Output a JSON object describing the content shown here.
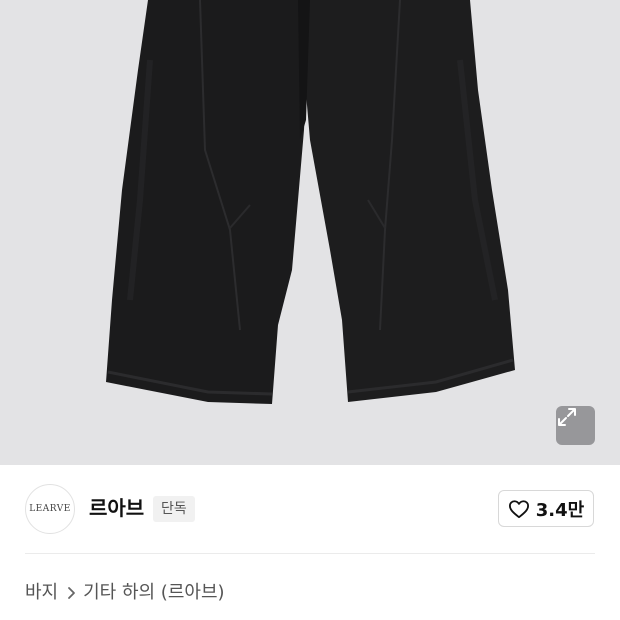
{
  "product_image": {
    "description_icon": "pants-photo",
    "expand_icon": "expand-icon"
  },
  "brand": {
    "logo_text": "LEARVE",
    "name": "르아브",
    "badge": "단독"
  },
  "like": {
    "icon": "heart-icon",
    "count": "3.4만"
  },
  "breadcrumb": {
    "items": [
      "바지",
      "기타 하의 (르아브)"
    ],
    "separator_icon": "chevron-right-icon"
  }
}
